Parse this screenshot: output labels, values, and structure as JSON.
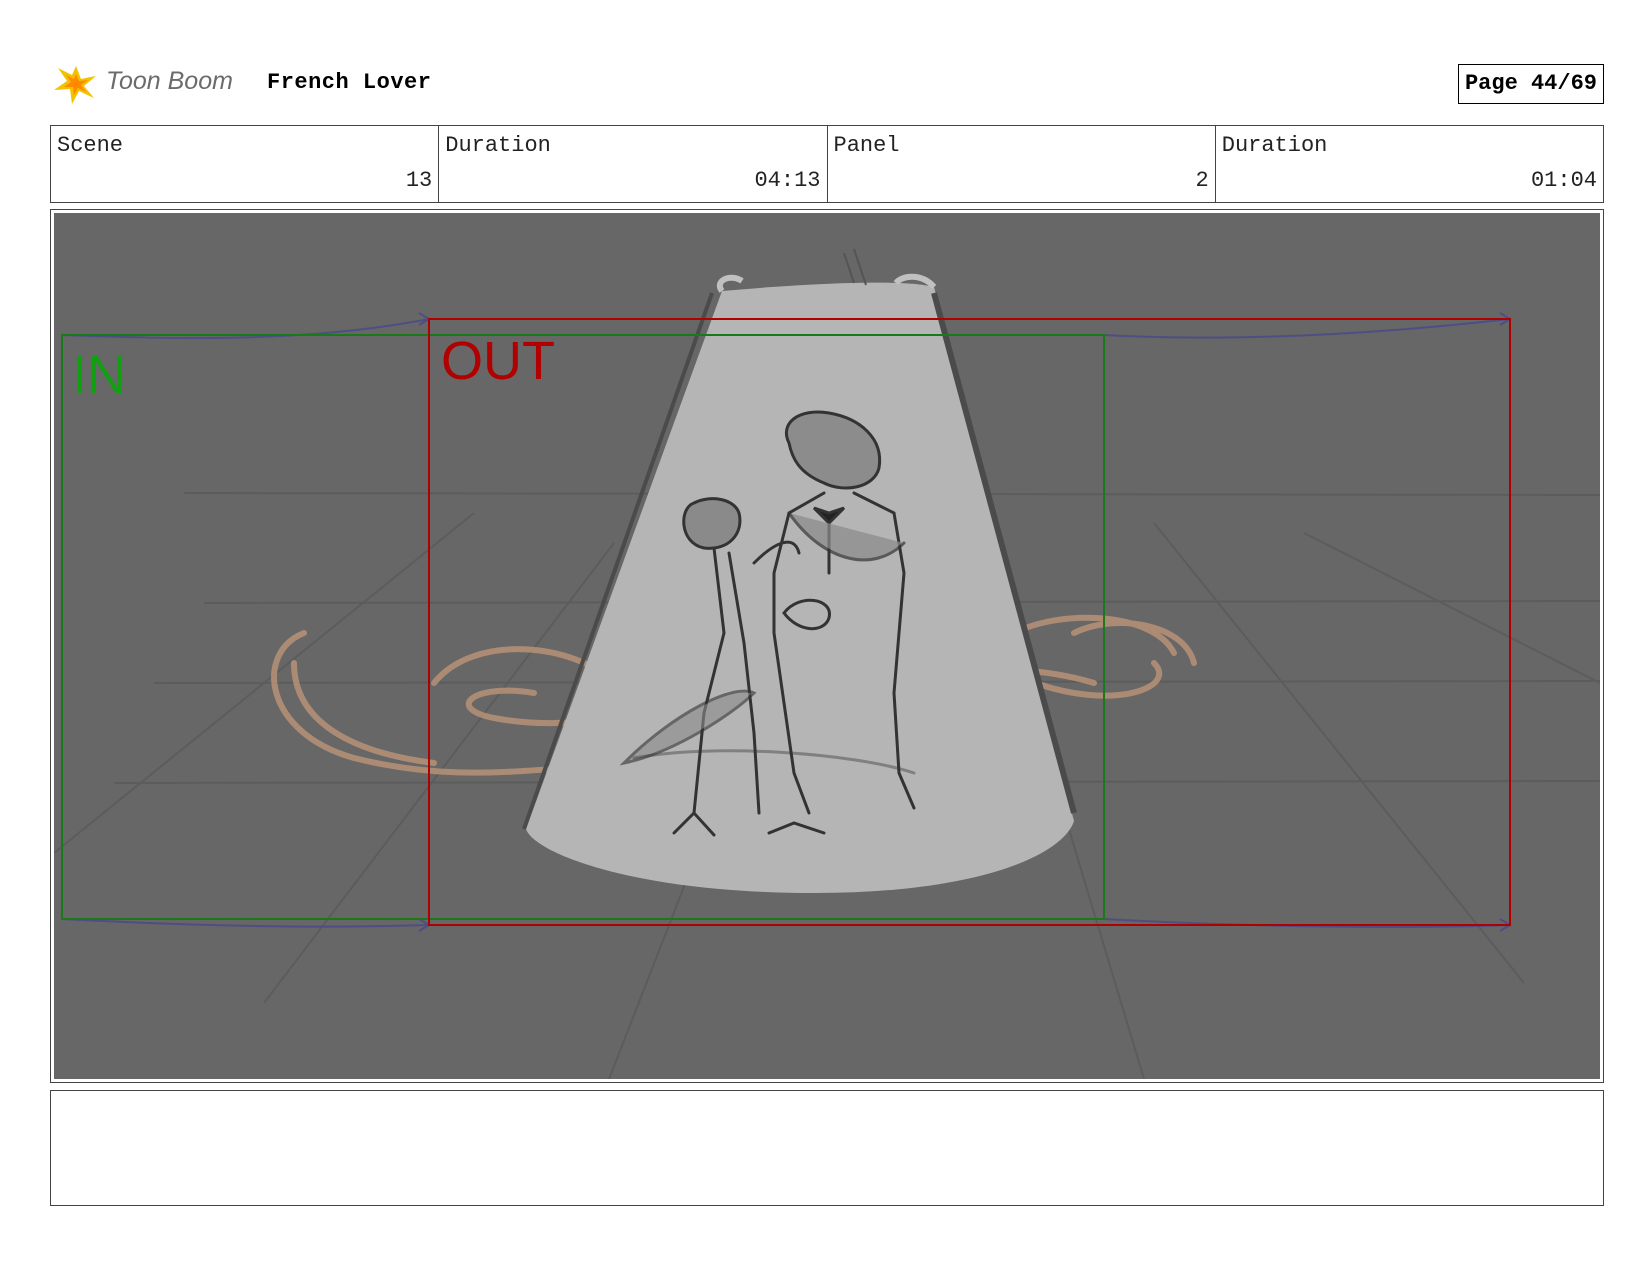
{
  "header": {
    "logo_text": "Toon Boom",
    "project_title": "French Lover",
    "page_label": "Page 44/69"
  },
  "info": [
    {
      "label": "Scene",
      "value": "13"
    },
    {
      "label": "Duration",
      "value": "04:13"
    },
    {
      "label": "Panel",
      "value": "2"
    },
    {
      "label": "Duration",
      "value": "01:04"
    }
  ],
  "panel": {
    "in_label": "IN",
    "out_label": "OUT",
    "colors": {
      "in_frame": "#1a7a1a",
      "out_frame": "#b00000",
      "background": "#676767",
      "spotlight": "#b3b3b3",
      "motion_arrows": "#4a4a8a",
      "swirls": "#c79a7a"
    }
  },
  "notes": {
    "text": ""
  }
}
